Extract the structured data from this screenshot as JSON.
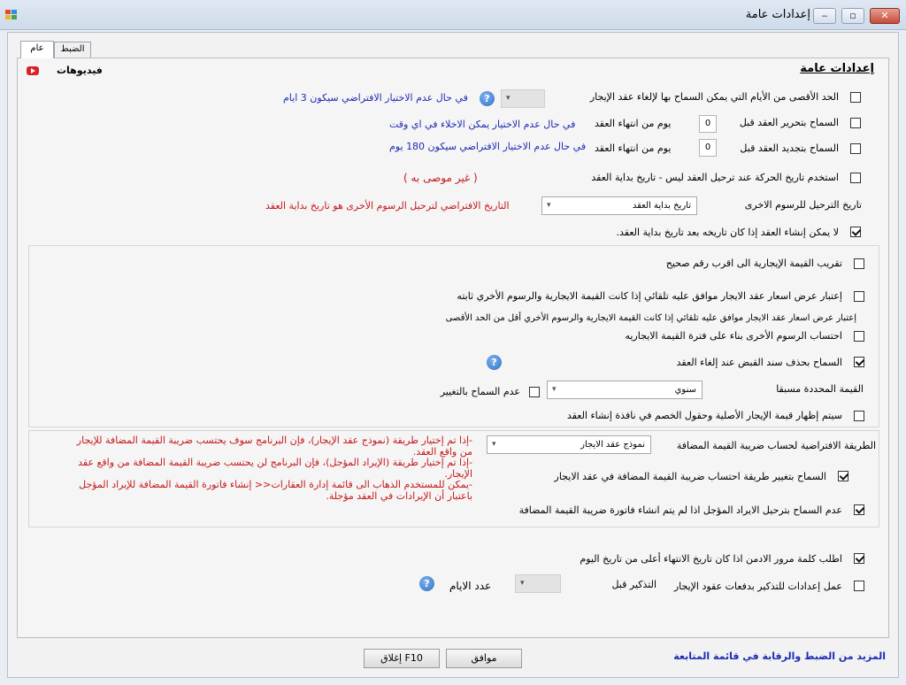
{
  "window": {
    "title": "إعدادات عامة",
    "minimize_glyph": "‒",
    "restore_glyph": "▫",
    "close_glyph": "✕"
  },
  "tabs": [
    {
      "label": "عام"
    },
    {
      "label": "الضبط"
    }
  ],
  "panel": {
    "heading": "إعدادات عامة",
    "videos_label": "فيديوهات",
    "videos_icon": "youtube-icon"
  },
  "general": {
    "max_days_label": "الحد الأقصى من الأيام التي يمكن السماح بها لإلغاء عقد الإيجار",
    "max_days_hint": "في حال عدم الاختيار الافتراضي سيكون 3 ايام",
    "edit_before_label": "السماح بتحرير العقد قبل",
    "edit_before_value": "0",
    "edit_before_unit": "يوم من انتهاء العقد",
    "edit_before_hint": "في حال عدم الاختيار يمكن الاخلاء في اي وقت",
    "renew_before_label": "السماح بتجديد العقد قبل",
    "renew_before_value": "0",
    "renew_before_unit": "يوم من انتهاء العقد",
    "renew_before_hint": "في حال عدم الاختيار الافتراضي سيكون 180 يوم",
    "use_move_date_label": "استخدم تاريخ الحركة عند ترحيل العقد ليس - تاريخ بداية العقد",
    "not_recommended": "( غير موصى به )",
    "other_fees_date_label": "تاريخ الترحيل للرسوم الاخرى",
    "other_fees_date_value": "تاريخ بداية العقد",
    "other_fees_date_hint": "التاريخ الافتراضي لترحيل الرسوم الأخرى هو تاريخ بداية العقد",
    "no_create_after_start_label": "لا يمكن إنشاء العقد إذا كان تاريخه بعد تاريخ بداية العقد."
  },
  "rent": {
    "round_label": "تقريب القيمة الإيجارية الى اقرب رقم صحيح",
    "quote_fixed_label": "إعتبار عرض اسعار عقد الايجار موافق عليه تلقائي  إذا كانت القيمة الايجارية والرسوم الأخري ثابته",
    "quote_less_label": "إعتبار عرض اسعار عقد الايجار موافق عليه تلقائي  إذا كانت القيمة الايجارية والرسوم الأخري أقل من الحد الأقصى",
    "calc_other_fees_label": "احتساب الرسوم الأخرى بناء على فترة القيمة الايجاريه",
    "delete_receipt_label": "السماح بحذف سند القبض عند إلغاء العقد",
    "preset_value_label": "القيمة المحددة مسبقا",
    "preset_value": "سنوي",
    "no_change_label": "عدم السماح بالتغيير",
    "show_original_label": "سيتم إظهار قيمة الإيجار الأصلية وحقول الخصم في نافذة إنشاء العقد"
  },
  "vat": {
    "method_label": "الطريقة  الافتراضية لحساب ضريبة القيمة المضافة",
    "method_value": "نموذج عقد الايجار",
    "allow_change_label": "السماح بتغيير طريقة احتساب ضريبة القيمة المضافة في عقد الايجار",
    "block_posting_label": "عدم السماح بترحيل الايراد المؤجل اذا لم يتم انشاء فاتورة ضريبة القيمة المضافة",
    "notes": [
      "-إذا تم إختيار طريقة (نموذج عقد الإيجار)، فإن البرنامج سوف يحتسب ضريبة القيمة المضافة للإيجار",
      "من  واقع العقد.",
      "-إذا تم إختيار طريقة (الإيراد المؤجل)، فإن البرنامج لن يحتسب ضريبة القيمة المضافة من واقع عقد",
      "الإيجار.",
      "-يمكن للمستخدم الذهاب الى قائمة إدارة العقارات<<  إنشاء فاتورة القيمة المضافة للإيراد المؤجل",
      "باعتبار  أن الإيرادات في العقد مؤجلة."
    ]
  },
  "bottom": {
    "admin_password_label": "اطلب كلمة مرور الادمن اذا كان تاريخ الانتهاء أعلى من تاريخ اليوم",
    "reminder_settings_label": "عمل إعدادات للتذكير بدفعات عقود الإيجار",
    "remind_before_label": "التذكير قبل",
    "days_count_label": "عدد الايام"
  },
  "footer": {
    "more_link": "المزيد من الضبط والرقابة في قائمة المتابعة",
    "ok_label": "موافق",
    "close_label": "إغلاق F10"
  },
  "colors": {
    "link_blue": "#1c2bb4",
    "note_red": "#c4191b",
    "help_blue": "#2f6fc4",
    "youtube_red": "#d92323"
  }
}
